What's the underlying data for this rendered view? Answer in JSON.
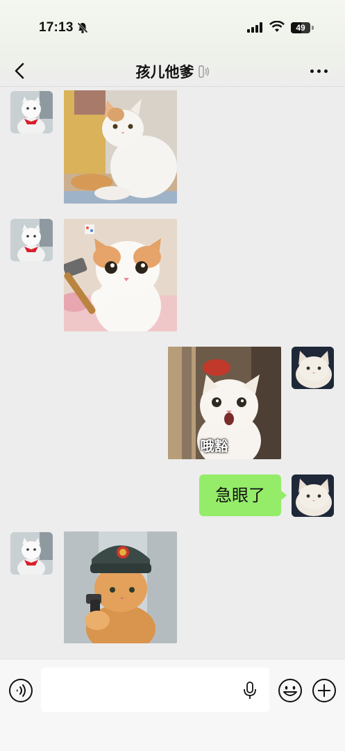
{
  "status_bar": {
    "time": "17:13",
    "battery": "49"
  },
  "nav": {
    "title": "孩儿他爹"
  },
  "messages": [
    {
      "side": "left",
      "kind": "sticker",
      "depicts": "white cat sitting"
    },
    {
      "side": "left",
      "kind": "sticker",
      "depicts": "cat holding hammer"
    },
    {
      "side": "right",
      "kind": "sticker",
      "depicts": "surprised cat",
      "caption": "哦豁"
    },
    {
      "side": "right",
      "kind": "text",
      "text": "急眼了"
    },
    {
      "side": "left",
      "kind": "sticker",
      "depicts": "cat in fur hat with pistol"
    }
  ],
  "input_bar": {
    "placeholder": ""
  },
  "colors": {
    "bubble_green": "#95ec69",
    "background": "#ededed"
  }
}
